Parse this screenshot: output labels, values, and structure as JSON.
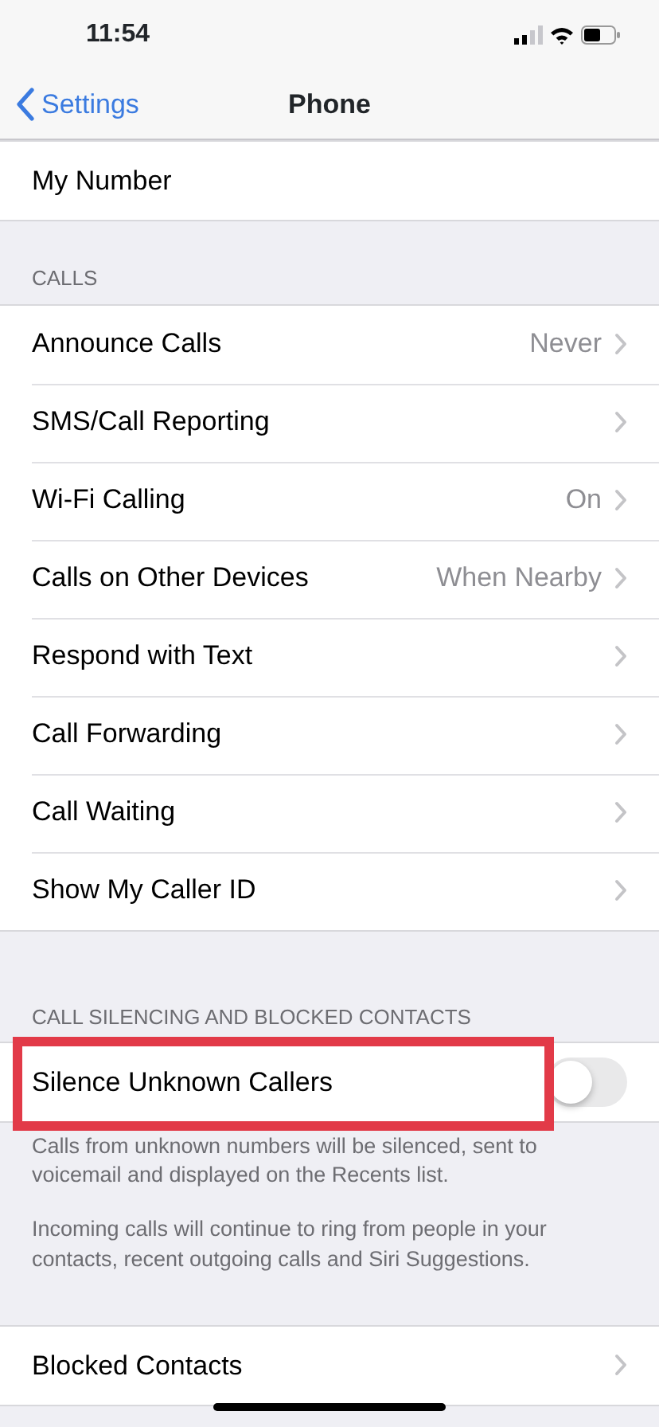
{
  "status_bar": {
    "time": "11:54"
  },
  "nav_bar": {
    "back_label": "Settings",
    "title": "Phone"
  },
  "sections": [
    {
      "rows": [
        {
          "kind": "plain",
          "label": "My Number"
        }
      ]
    },
    {
      "header": "CALLS",
      "rows": [
        {
          "kind": "link",
          "label": "Announce Calls",
          "value": "Never"
        },
        {
          "kind": "link",
          "label": "SMS/Call Reporting"
        },
        {
          "kind": "link",
          "label": "Wi-Fi Calling",
          "value": "On"
        },
        {
          "kind": "link",
          "label": "Calls on Other Devices",
          "value": "When Nearby"
        },
        {
          "kind": "link",
          "label": "Respond with Text"
        },
        {
          "kind": "link",
          "label": "Call Forwarding"
        },
        {
          "kind": "link",
          "label": "Call Waiting"
        },
        {
          "kind": "link",
          "label": "Show My Caller ID"
        }
      ]
    },
    {
      "header": "CALL SILENCING AND BLOCKED CONTACTS",
      "rows": [
        {
          "kind": "toggle",
          "label": "Silence Unknown Callers",
          "on": false,
          "highlighted": true
        }
      ],
      "footer": [
        "Calls from unknown numbers will be silenced, sent to voicemail and displayed on the Recents list.",
        "Incoming calls will continue to ring from people in your contacts, recent outgoing calls and Siri Suggestions."
      ]
    },
    {
      "rows": [
        {
          "kind": "link",
          "label": "Blocked Contacts"
        }
      ]
    }
  ]
}
